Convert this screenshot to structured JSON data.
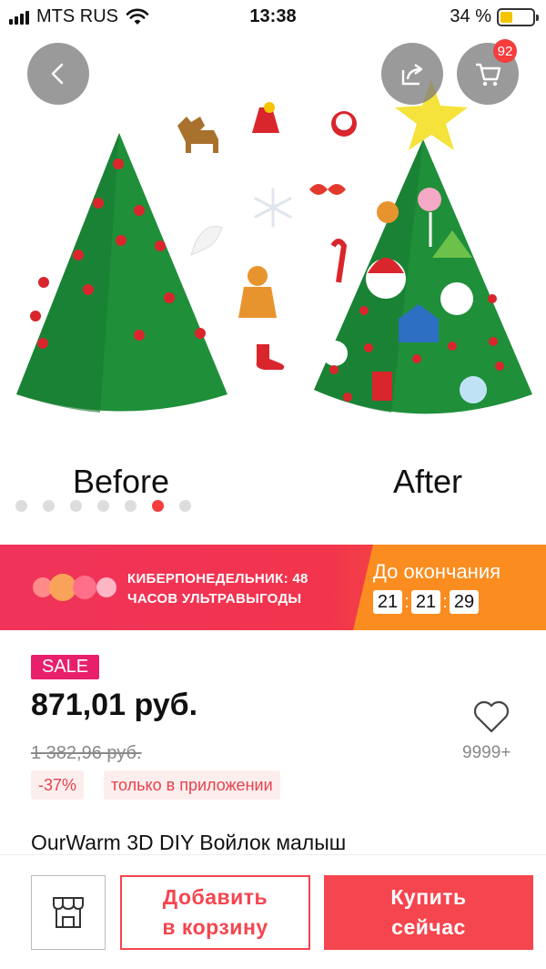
{
  "status_bar": {
    "carrier": "MTS RUS",
    "time": "13:38",
    "battery": "34 %"
  },
  "gallery": {
    "caption_before": "Before",
    "caption_after": "After",
    "cart_badge": "92",
    "dots_total": 7,
    "active_dot": 5
  },
  "promo": {
    "line1": "КИБЕРПОНЕДЕЛЬНИК: 48",
    "line2": "ЧАСОВ УЛЬТРАВЫГОДЫ",
    "countdown_label": "До окончания",
    "hours": "21",
    "minutes": "21",
    "seconds": "29"
  },
  "product": {
    "sale_badge": "SALE",
    "price": "871,01 руб.",
    "old_price": "1 382,96 руб.",
    "wishlist_count": "9999+",
    "discount": "-37%",
    "app_only": "только в приложении",
    "title": "OurWarm 3D DIY Войлок малыш"
  },
  "actions": {
    "add_line1": "Добавить",
    "add_line2": "в корзину",
    "buy_line1": "Купить",
    "buy_line2": "сейчас"
  },
  "colors": {
    "accent": "#f5454f",
    "sale": "#e8206b",
    "countdown": "#fb8c1f",
    "tree": "#1f8f3a"
  }
}
